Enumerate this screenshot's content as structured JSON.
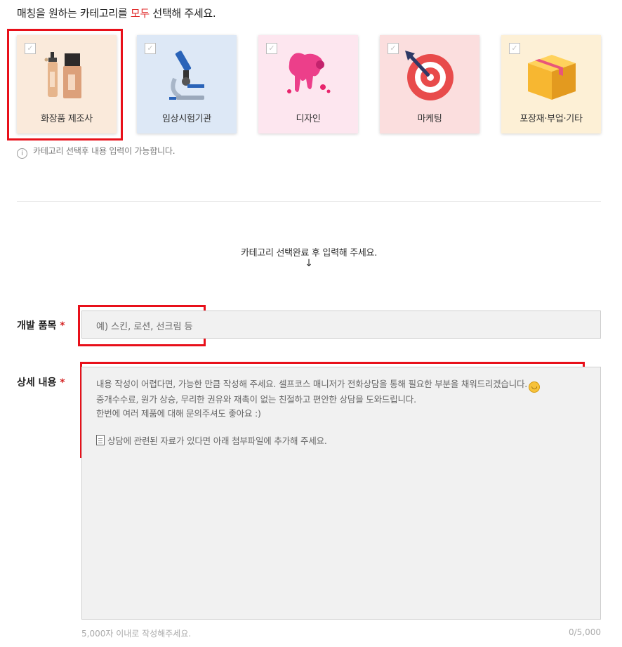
{
  "heading": {
    "prefix": "매칭을 원하는 카테고리를 ",
    "highlight": "모두",
    "suffix": " 선택해 주세요."
  },
  "categories": [
    {
      "label": "화장품 제조사",
      "icon": "cosmetic-bottles-icon",
      "bg": "#faeadb"
    },
    {
      "label": "임상시험기관",
      "icon": "microscope-icon",
      "bg": "#dde8f6"
    },
    {
      "label": "디자인",
      "icon": "paint-splash-icon",
      "bg": "#fde6ef"
    },
    {
      "label": "마케팅",
      "icon": "target-dart-icon",
      "bg": "#fbdede"
    },
    {
      "label": "포장재·부업·기타",
      "icon": "box-icon",
      "bg": "#fdf0d6"
    }
  ],
  "info_text": "카테고리 선택후 내용 입력이 가능합니다.",
  "notice": {
    "text": "카테고리 선택완료 후 입력해 주세요.",
    "arrow": "↓"
  },
  "product_field": {
    "label": "개발 품목",
    "required": "*",
    "placeholder": "예) 스킨, 로션, 선크림 등"
  },
  "detail_field": {
    "label": "상세 내용",
    "required": "*",
    "lines": [
      "내용 작성이 어렵다면, 가능한 만큼 작성해 주세요. 셀프코스 매니저가 전화상담을 통해 필요한 부분을 채워드리겠습니다.",
      "중개수수료, 원가 상승, 무리한 권유와 재촉이 없는 친절하고 편안한 상담을 도와드립니다.",
      "한번에 여러 제품에 대해 문의주셔도 좋아요 :)",
      "",
      "상담에 관련된 자료가 있다면 아래 첨부파일에 추가해 주세요."
    ],
    "hint": "5,000자 이내로 작성해주세요.",
    "count": "0/5,000"
  }
}
